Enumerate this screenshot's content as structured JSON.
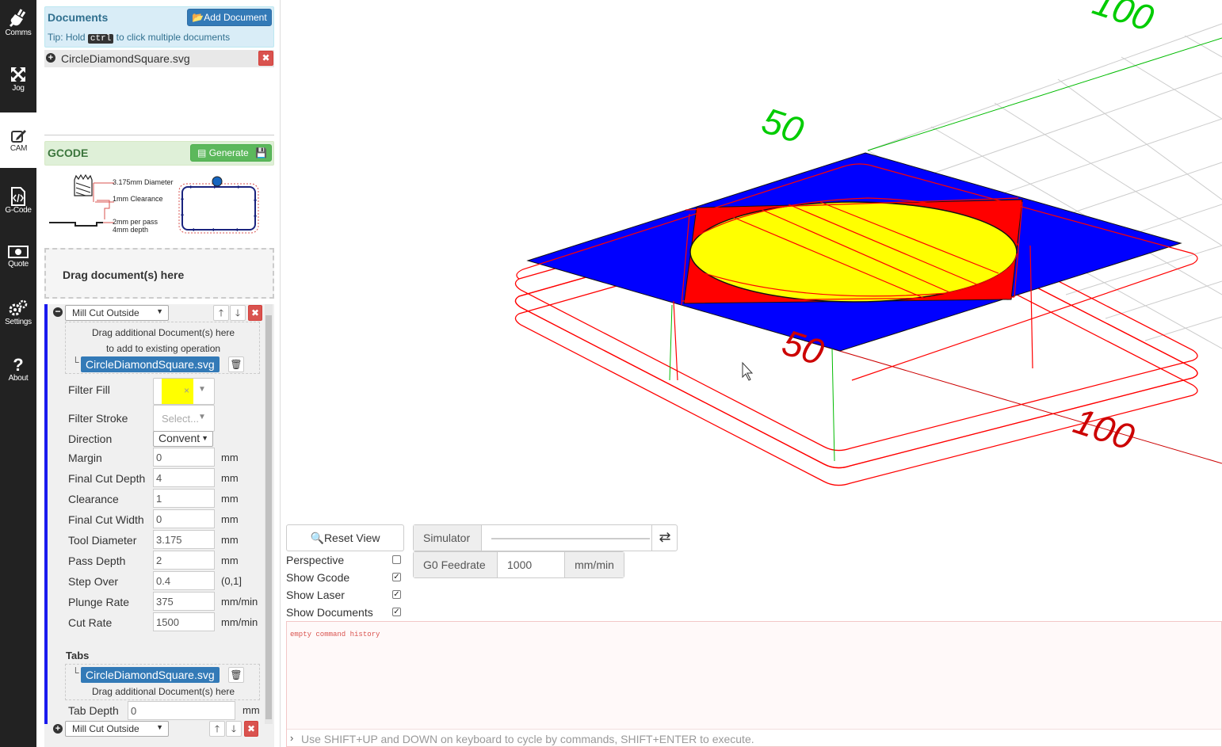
{
  "sidebar": {
    "items": [
      {
        "label": "Comms",
        "icon": "plug-icon"
      },
      {
        "label": "Jog",
        "icon": "move-arrows-icon"
      },
      {
        "label": "CAM",
        "icon": "edit-icon"
      },
      {
        "label": "G-Code",
        "icon": "code-file-icon"
      },
      {
        "label": "Quote",
        "icon": "money-icon"
      },
      {
        "label": "Settings",
        "icon": "gears-icon"
      },
      {
        "label": "About",
        "icon": "question-icon"
      }
    ],
    "active": "CAM"
  },
  "documents": {
    "title": "Documents",
    "add_label": "Add Document",
    "tip_prefix": "Tip: Hold",
    "tip_key": "ctrl",
    "tip_suffix": "to click multiple documents",
    "files": [
      "CircleDiamondSquare.svg"
    ]
  },
  "gcode": {
    "title": "GCODE",
    "generate_label": "Generate",
    "diagram": {
      "diameter": "3.175mm Diameter",
      "clearance": "1mm Clearance",
      "per_pass": "2mm per pass",
      "depth": "4mm depth"
    },
    "drop_label": "Drag document(s) here"
  },
  "operation": {
    "type": "Mill Cut Outside",
    "drag_hint_1": "Drag additional Document(s) here",
    "drag_hint_2": "to add to existing operation",
    "doc": "CircleDiamondSquare.svg",
    "fields": [
      {
        "label": "Filter Fill",
        "value": ""
      },
      {
        "label": "Filter Stroke",
        "value": "Select..."
      },
      {
        "label": "Direction",
        "value": "Convent"
      },
      {
        "label": "Margin",
        "value": "0",
        "unit": "mm"
      },
      {
        "label": "Final Cut Depth",
        "value": "4",
        "unit": "mm"
      },
      {
        "label": "Clearance",
        "value": "1",
        "unit": "mm"
      },
      {
        "label": "Final Cut Width",
        "value": "0",
        "unit": "mm"
      },
      {
        "label": "Tool Diameter",
        "value": "3.175",
        "unit": "mm"
      },
      {
        "label": "Pass Depth",
        "value": "2",
        "unit": "mm"
      },
      {
        "label": "Step Over",
        "value": "0.4",
        "unit": "(0,1]"
      },
      {
        "label": "Plunge Rate",
        "value": "375",
        "unit": "mm/min"
      },
      {
        "label": "Cut Rate",
        "value": "1500",
        "unit": "mm/min"
      }
    ],
    "fill_color": "#ffff00",
    "tabs_title": "Tabs",
    "tabs_doc": "CircleDiamondSquare.svg",
    "tabs_hint": "Drag additional Document(s) here",
    "tab_depth_label": "Tab Depth",
    "tab_depth_value": "0",
    "tab_depth_unit": "mm",
    "next_type": "Mill Cut Outside"
  },
  "viewer": {
    "axis_labels": {
      "y_far": "100",
      "y_mid": "50",
      "x_mid": "50",
      "x_far": "100"
    },
    "colors": {
      "grid": "#cccccc",
      "x_axis": "#cc0000",
      "y_axis": "#00bb00",
      "square": "#0000ff",
      "diamond": "#ff0000",
      "circle": "#ffff00",
      "toolpath": "#ff0000"
    }
  },
  "controls": {
    "reset_view": "Reset View",
    "simulator": "Simulator",
    "g0_feedrate_label": "G0 Feedrate",
    "g0_feedrate_value": "1000",
    "g0_feedrate_unit": "mm/min",
    "perspective": "Perspective",
    "show_gcode": "Show Gcode",
    "show_laser": "Show Laser",
    "show_documents": "Show Documents",
    "perspective_checked": false,
    "show_gcode_checked": true,
    "show_laser_checked": true,
    "show_documents_checked": true
  },
  "console": {
    "history": "empty command history",
    "hint": "Use SHIFT+UP and DOWN on keyboard to cycle by commands, SHIFT+ENTER to execute."
  }
}
